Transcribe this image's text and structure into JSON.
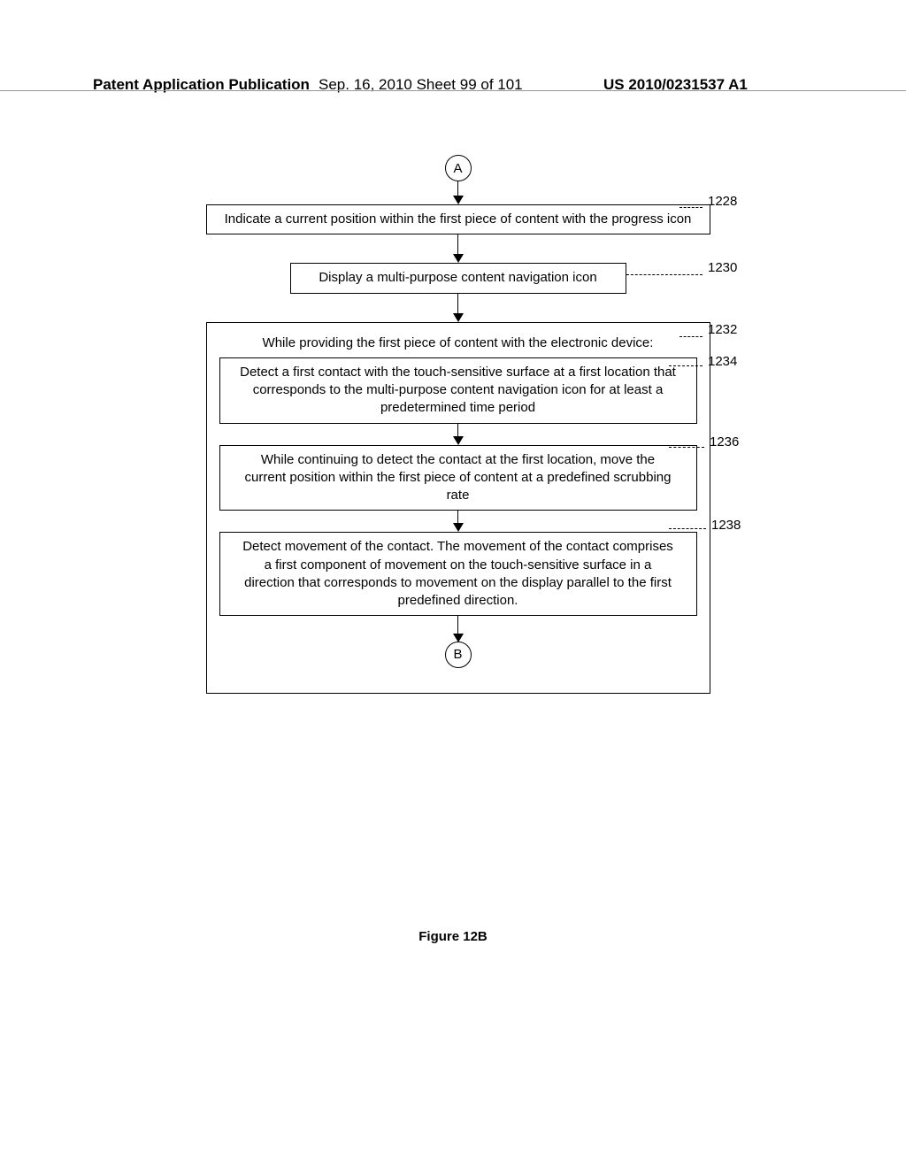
{
  "header": {
    "publication_type": "Patent Application Publication",
    "date_sheet": "Sep. 16, 2010  Sheet 99 of 101",
    "pub_number": "US 2010/0231537 A1"
  },
  "figure_caption": "Figure 12B",
  "flow": {
    "connector_top": "A",
    "connector_bottom": "B",
    "step_1228": {
      "ref": "1228",
      "text": "Indicate a current position within the first piece of content with the progress icon"
    },
    "step_1230": {
      "ref": "1230",
      "text": "Display a multi-purpose content navigation icon"
    },
    "step_1232": {
      "ref": "1232",
      "title": "While providing the first piece of content with the electronic device:",
      "step_1234": {
        "ref": "1234",
        "text": "Detect a first contact with the touch-sensitive surface at a first location that corresponds to the multi-purpose content navigation icon for at least a predetermined time period"
      },
      "step_1236": {
        "ref": "1236",
        "text": "While continuing to detect the contact at the first location, move the current position within the first piece of content at a predefined scrubbing rate"
      },
      "step_1238": {
        "ref": "1238",
        "text": "Detect movement of the contact.  The movement of the contact comprises a first component of movement on the touch-sensitive surface in a direction that corresponds to movement on the display parallel to the first predefined direction."
      }
    }
  }
}
